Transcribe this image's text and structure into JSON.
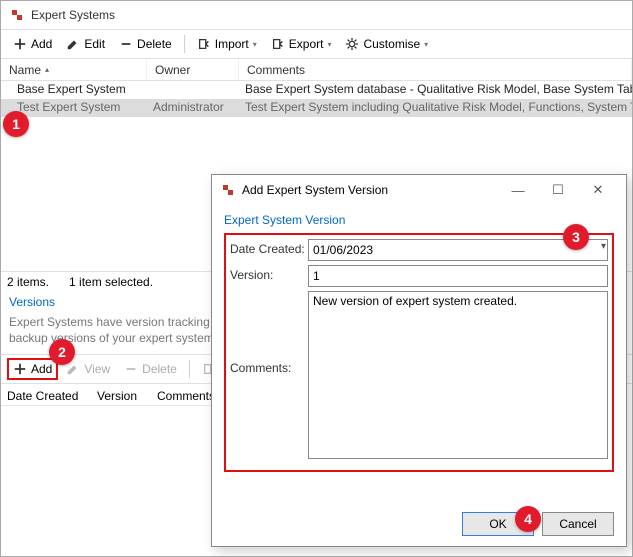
{
  "window": {
    "title": "Expert Systems"
  },
  "toolbar": {
    "add": "Add",
    "edit": "Edit",
    "delete": "Delete",
    "import": "Import",
    "export": "Export",
    "customise": "Customise"
  },
  "grid": {
    "headers": {
      "name": "Name",
      "owner": "Owner",
      "comments": "Comments"
    },
    "rows": [
      {
        "name": "Base Expert System",
        "owner": "",
        "comments": "Base Expert System database - Qualitative Risk Model, Base System Table d"
      },
      {
        "name": "Test Expert System",
        "owner": "Administrator",
        "comments": "Test Expert System including Qualitative Risk Model, Functions, System Tab"
      }
    ]
  },
  "status": {
    "count": "2 items.",
    "selected": "1 item selected."
  },
  "versions": {
    "title": "Versions",
    "help": "Expert Systems have version tracking which enables backup versions of your expert system to be imported",
    "toolbar": {
      "add": "Add",
      "view": "View",
      "delete": "Delete"
    },
    "headers": {
      "date": "Date Created",
      "version": "Version",
      "comments": "Comments"
    }
  },
  "dialog": {
    "title": "Add Expert System Version",
    "section": "Expert System Version",
    "labels": {
      "date": "Date Created:",
      "version": "Version:",
      "comments": "Comments:"
    },
    "values": {
      "date": "01/06/2023",
      "version": "1",
      "comments": "New version of expert system created."
    },
    "buttons": {
      "ok": "OK",
      "cancel": "Cancel"
    }
  },
  "annotations": {
    "a1": "1",
    "a2": "2",
    "a3": "3",
    "a4": "4"
  }
}
